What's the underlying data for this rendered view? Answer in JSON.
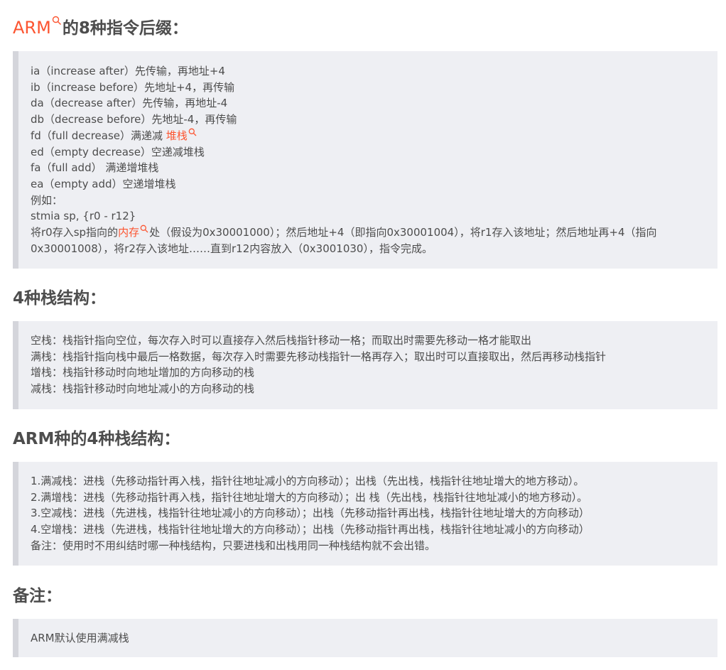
{
  "heading1": {
    "prefix": "ARM",
    "suffix": "的8种指令后缀："
  },
  "block1": {
    "lines": [
      "ia（increase after）先传输，再地址+4",
      "ib（increase before）先地址+4，再传输",
      "da（decrease after）先传输，再地址-4",
      "db（decrease before）先地址-4，再传输"
    ],
    "fd_prefix": "fd（full decrease）满递减 ",
    "fd_link": "堆栈",
    "lines2": [
      "ed（empty decrease）空递减堆栈",
      "fa（full add） 满递增堆栈",
      "ea（empty add）空递增堆栈",
      "例如：",
      "stmia sp, {r0 - r12}"
    ],
    "para_prefix": "将r0存入sp指向的",
    "para_link": "内存",
    "para_suffix": "处（假设为0x30001000）；然后地址+4（即指向0x30001004），将r1存入该地址；然后地址再+4（指向0x30001008），将r2存入该地址……直到r12内容放入（0x3001030），指令完成。"
  },
  "heading2": "4种栈结构：",
  "block2": {
    "lines": [
      "空栈：栈指针指向空位，每次存入时可以直接存入然后栈指针移动一格；而取出时需要先移动一格才能取出",
      "满栈：栈指针指向栈中最后一格数据，每次存入时需要先移动栈指针一格再存入；取出时可以直接取出，然后再移动栈指针",
      "增栈：栈指针移动时向地址增加的方向移动的栈",
      "减栈：栈指针移动时向地址减小的方向移动的栈"
    ]
  },
  "heading3": "ARM种的4种栈结构：",
  "block3": {
    "lines": [
      "1.满减栈：进栈（先移动指针再入栈，指针往地址减小的方向移动）；出栈（先出栈，栈指针往地址增大的地方移动）。",
      "2.满增栈：进栈（先移动指针再入栈，指针往地址增大的方向移动）；出 栈（先出栈，栈指针往地址减小的地方移动）。",
      "3.空减栈：进栈（先进栈，栈指针往地址减小的方向移动）；出栈（先移动指针再出栈，栈指针往地址增大的方向移动）",
      "4.空增栈：进栈（先进栈，栈指针往地址增大的方向移动）；出栈（先移动指针再出栈，栈指针往地址减小的方向移动）",
      "备注：使用时不用纠结时哪一种栈结构，只要进栈和出栈用同一种栈结构就不会出错。"
    ]
  },
  "heading4": "备注：",
  "block4": {
    "lines": [
      "ARM默认使用满减栈"
    ]
  },
  "colors": {
    "link": "#fc5531",
    "text": "#4d4d4d",
    "block_bg": "#eeeff3",
    "block_border": "#d4d5db"
  },
  "icons": {
    "keyword_search": "search-icon"
  }
}
